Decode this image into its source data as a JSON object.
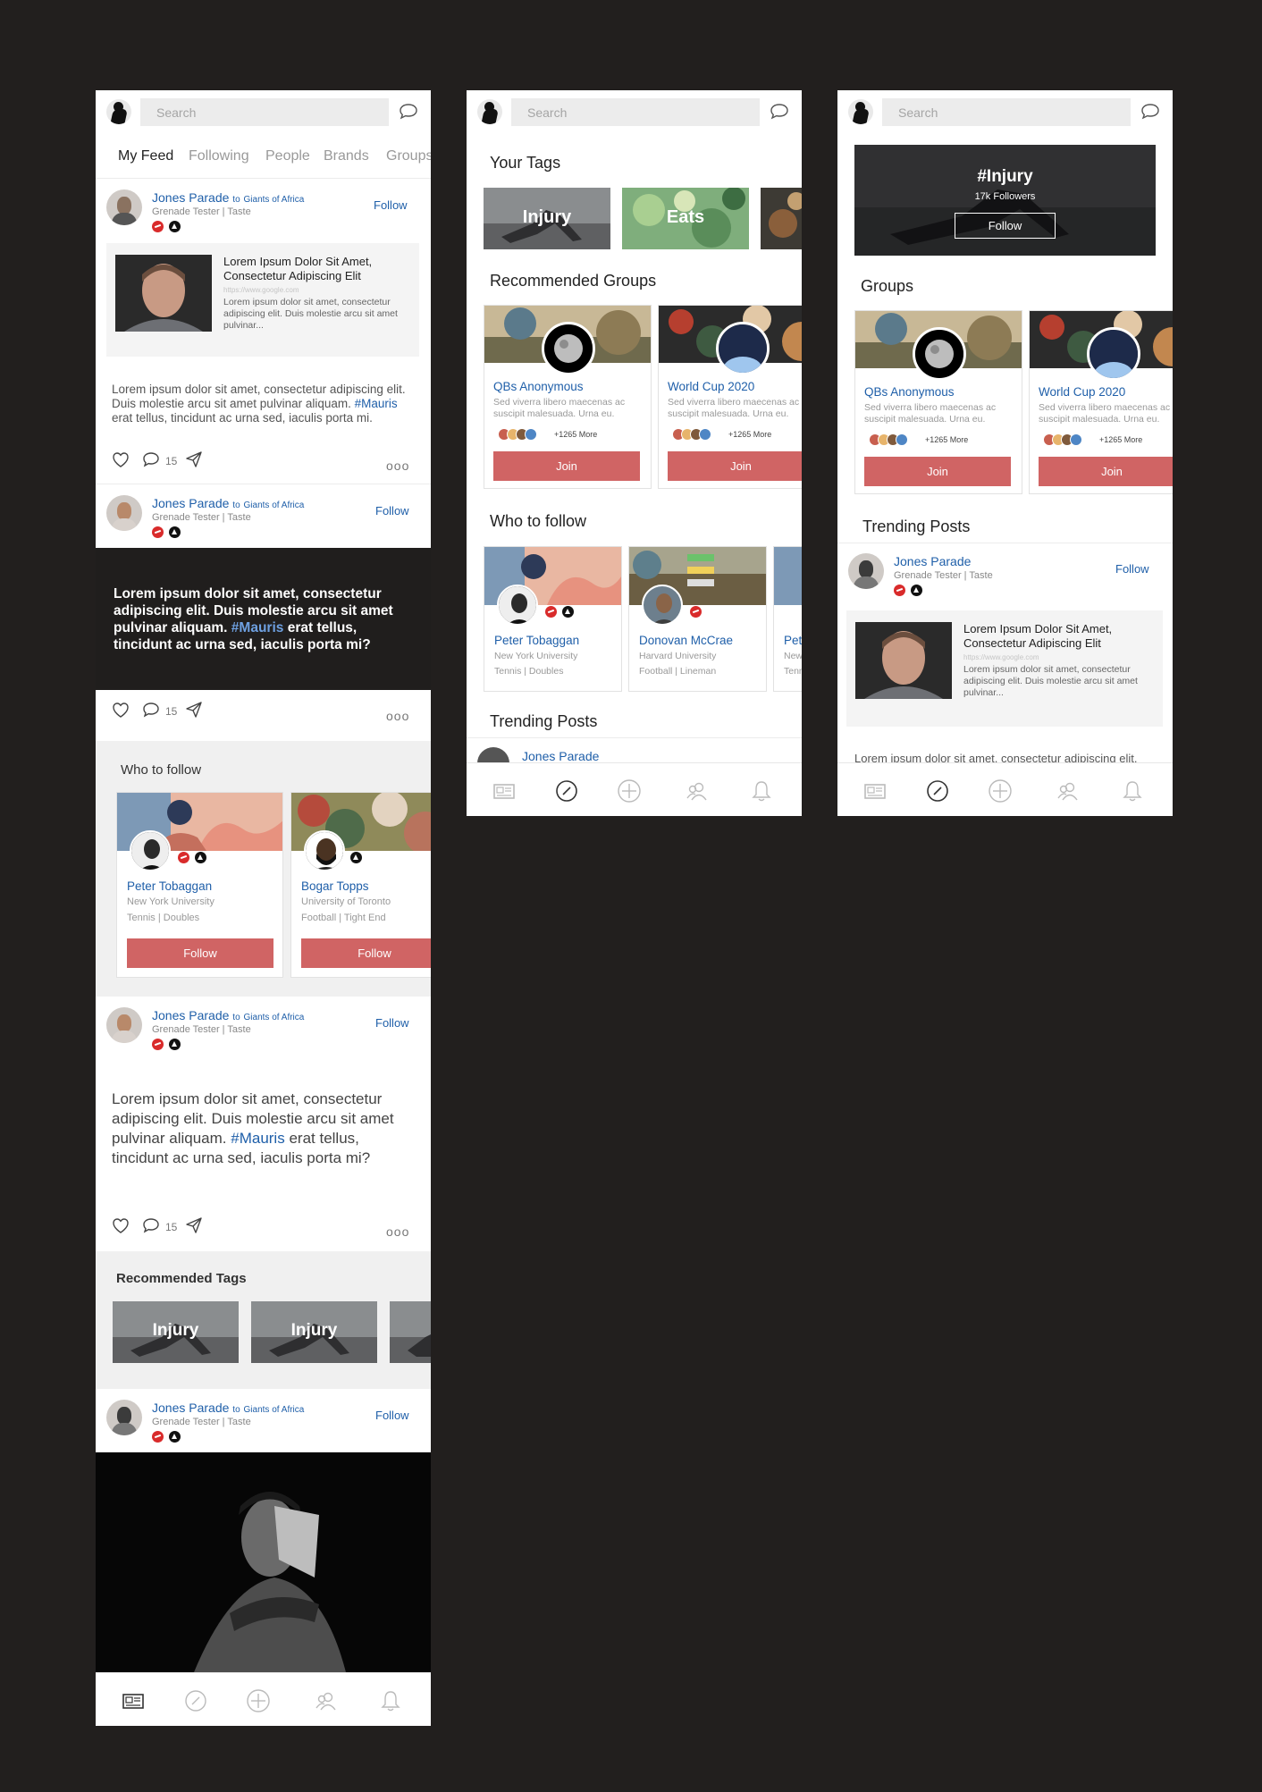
{
  "search": {
    "placeholder": "Search"
  },
  "feed": {
    "tabs": [
      "My Feed",
      "Following",
      "People",
      "Brands",
      "Groups"
    ],
    "post_author": "Jones Parade",
    "post_to": "to",
    "post_group": "Giants of Africa",
    "post_subtitle": "Grenade Tester | Taste",
    "follow_label": "Follow",
    "preview": {
      "title": "Lorem Ipsum Dolor Sit Amet, Consectetur Adipiscing Elit",
      "url": "https://www.google.com",
      "desc": "Lorem ipsum dolor sit amet, consectetur adipiscing elit. Duis molestie arcu sit amet pulvinar..."
    },
    "body_a": "Lorem ipsum dolor sit amet, consectetur adipiscing elit. Duis molestie arcu sit amet pulvinar aliquam.",
    "body_hashtag": "#Mauris",
    "body_b": "erat tellus, tincidunt ac urna sed, iaculis porta mi.",
    "quote_a": "Lorem ipsum dolor sit amet, consectetur adipiscing elit. Duis molestie arcu sit amet pulvinar aliquam.",
    "quote_b": "erat tellus, tincidunt ac urna sed, iaculis porta mi?",
    "comment_count": "15",
    "more": "ooo",
    "who_to_follow": "Who to follow",
    "people": [
      {
        "name": "Peter Tobaggan",
        "line1": "New York University",
        "line2": "Tennis | Doubles",
        "btn": "Follow"
      },
      {
        "name": "Bogar Topps",
        "line1": "University of Toronto",
        "line2": "Football | Tight End",
        "btn": "Follow"
      }
    ],
    "recommended_tags": "Recommended Tags",
    "tag_injury": "Injury"
  },
  "explore": {
    "your_tags": "Your Tags",
    "tags": [
      "Injury",
      "Eats"
    ],
    "recommended_groups": "Recommended Groups",
    "groups": [
      {
        "name": "QBs Anonymous",
        "desc": "Sed viverra libero maecenas ac suscipit malesuada. Urna eu.",
        "more": "+1265 More",
        "btn": "Join"
      },
      {
        "name": "World Cup 2020",
        "desc": "Sed viverra libero maecenas ac suscipit malesuada. Urna eu.",
        "more": "+1265 More",
        "btn": "Join"
      }
    ],
    "who_to_follow": "Who to follow",
    "people": [
      {
        "name": "Peter Tobaggan",
        "line1": "New York University",
        "line2": "Tennis | Doubles"
      },
      {
        "name": "Donovan McCrae",
        "line1": "Harvard University",
        "line2": "Football | Lineman"
      },
      {
        "name": "Peter Tobaggan",
        "line1": "New York University",
        "line2": "Tennis | Doubles"
      }
    ],
    "trending_posts": "Trending Posts",
    "trending_author": "Jones Parade"
  },
  "tag_page": {
    "hero_title": "#Injury",
    "hero_followers": "17k Followers",
    "hero_follow": "Follow",
    "groups_title": "Groups",
    "trending_posts": "Trending Posts",
    "trending_body": "Lorem ipsum dolor sit amet, consectetur adipiscing elit."
  },
  "colors": {
    "accent_blue": "#1f5fa9",
    "button_red": "#d06464",
    "background": "#221f1e"
  },
  "icons": [
    "logo-icon",
    "chat-icon",
    "heart-icon",
    "comment-icon",
    "share-icon",
    "more-icon",
    "feed-icon",
    "explore-icon",
    "add-icon",
    "people-icon",
    "bell-icon"
  ]
}
